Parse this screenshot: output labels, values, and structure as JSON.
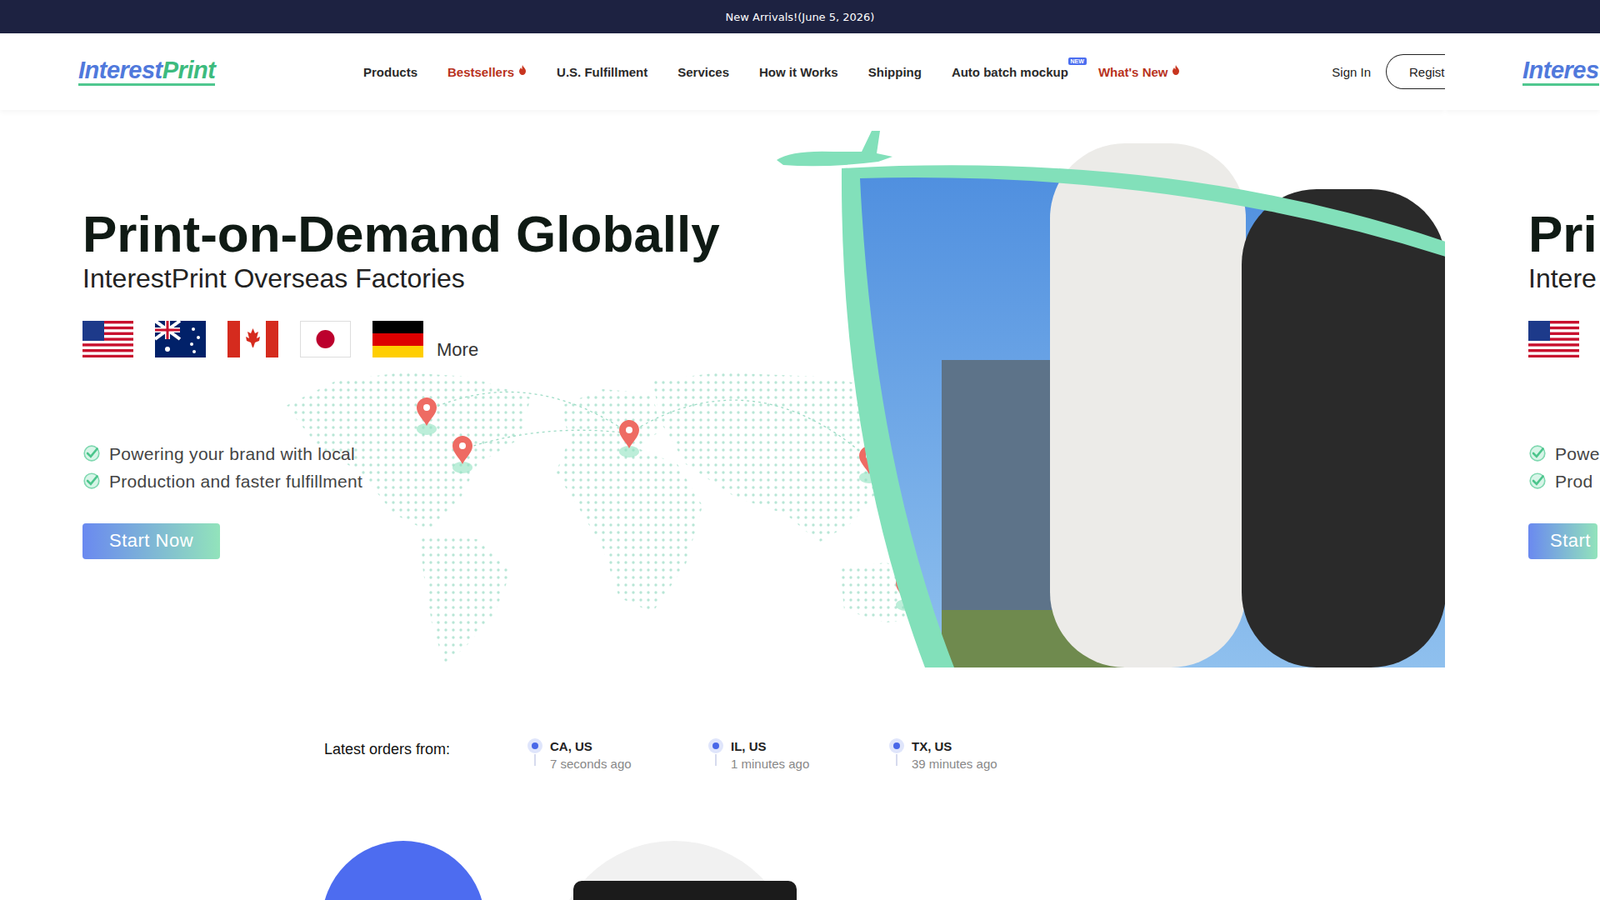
{
  "announcement": "New Arrivals!(June 5, 2026)",
  "logo": {
    "primary": "Interest",
    "secondary": "Print"
  },
  "nav": [
    {
      "label": "Products",
      "hot": false,
      "badge": ""
    },
    {
      "label": "Bestsellers",
      "hot": true,
      "badge": ""
    },
    {
      "label": "U.S. Fulfillment",
      "hot": false,
      "badge": ""
    },
    {
      "label": "Services",
      "hot": false,
      "badge": ""
    },
    {
      "label": "How it Works",
      "hot": false,
      "badge": ""
    },
    {
      "label": "Shipping",
      "hot": false,
      "badge": ""
    },
    {
      "label": "Auto batch mockup",
      "hot": false,
      "badge": "NEW"
    },
    {
      "label": "What's New",
      "hot": true,
      "badge": ""
    }
  ],
  "sign_in": "Sign In",
  "register": "Regist",
  "hero": {
    "title": "Print-on-Demand Globally",
    "subtitle": "InterestPrint Overseas Factories",
    "more": "More",
    "features": [
      "Powering your brand with local",
      "Production and faster fulfillment"
    ],
    "cta": "Start Now"
  },
  "latest_orders": {
    "label": "Latest orders from:",
    "orders": [
      {
        "location": "CA, US",
        "time": "7 seconds ago"
      },
      {
        "location": "IL, US",
        "time": "1 minutes ago"
      },
      {
        "location": "TX, US",
        "time": "39 minutes ago"
      }
    ]
  },
  "next_slide": {
    "logo": "Interes",
    "title": "Pri",
    "subtitle": "Intere",
    "features": [
      "Powe",
      "Prod"
    ],
    "cta": "Start"
  }
}
